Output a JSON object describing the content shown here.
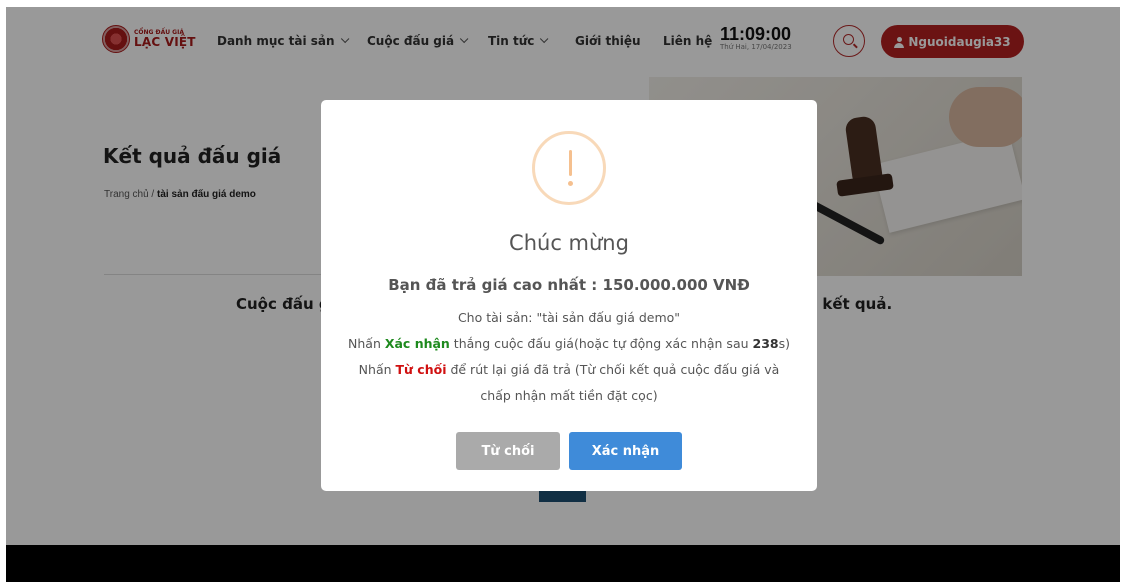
{
  "header": {
    "logo": {
      "top": "CỔNG ĐẤU GIÁ",
      "main": "LẠC VIỆT"
    },
    "nav": [
      {
        "label": "Danh mục tài sản",
        "dropdown": true
      },
      {
        "label": "Cuộc đấu giá",
        "dropdown": true
      },
      {
        "label": "Tin tức",
        "dropdown": true
      },
      {
        "label": "Giới thiệu",
        "dropdown": false
      },
      {
        "label": "Liên hệ",
        "dropdown": false
      }
    ],
    "clock": {
      "time": "11:09:00",
      "date": "Thứ Hai, 17/04/2023"
    },
    "search_icon": "search-icon",
    "user_label": "Nguoidaugia33"
  },
  "page": {
    "title": "Kết quả đấu giá",
    "breadcrumb": {
      "home": "Trang chủ",
      "sep": " / ",
      "current": "tài sản đấu giá demo"
    },
    "result_left": "Cuộc đấu g",
    "result_right": "i kết quả."
  },
  "modal": {
    "icon": "exclamation-icon",
    "title": "Chúc mừng",
    "highest": "Bạn đã trả giá cao nhất : 150.000.000 VNĐ",
    "asset": "Cho tài sản: \"tài sản đấu giá demo\"",
    "confirm_pre": "Nhấn ",
    "confirm_word": "Xác nhận",
    "confirm_mid": " thắng cuộc đấu giá(hoặc tự động xác nhận sau ",
    "countdown": "238",
    "confirm_post": "s)",
    "reject_pre": "Nhấn ",
    "reject_word": "Từ chối",
    "reject_post": " để rút lại giá đã trả (Từ chối kết quả cuộc đấu giá và",
    "reject_line2": "chấp nhận mất tiền đặt cọc)",
    "reject_button": "Từ chối",
    "confirm_button": "Xác nhận"
  },
  "colors": {
    "brand_red": "#b32020",
    "confirm_blue": "#3f8bd9",
    "reject_gray": "#aaaaaa",
    "warning": "#f5c08f"
  }
}
